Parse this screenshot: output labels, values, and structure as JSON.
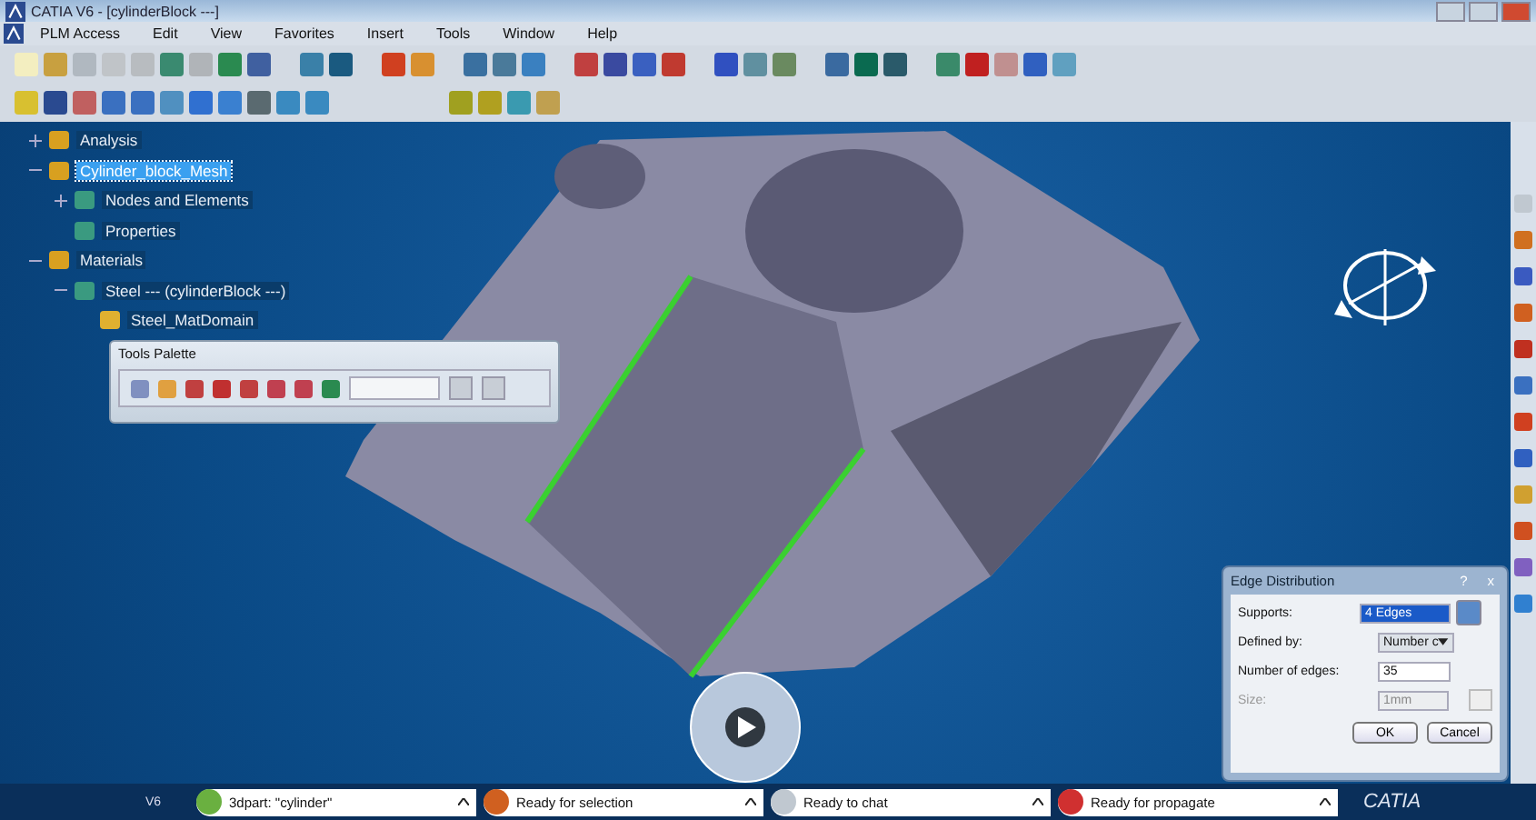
{
  "window": {
    "title": "CATIA V6 - [cylinderBlock ---]"
  },
  "menu": [
    "PLM Access",
    "Edit",
    "View",
    "Favorites",
    "Insert",
    "Tools",
    "Window",
    "Help"
  ],
  "tree": [
    {
      "label": "Analysis",
      "selected": false,
      "expanded": false
    },
    {
      "label": "Cylinder_block_Mesh",
      "selected": true,
      "expanded": true,
      "children": [
        {
          "label": "Nodes and Elements",
          "selected": false,
          "expanded": false
        },
        {
          "label": "Properties",
          "selected": false
        }
      ]
    },
    {
      "label": "Materials",
      "selected": false,
      "expanded": true,
      "children": [
        {
          "label": "Steel --- (cylinderBlock ---)",
          "selected": false,
          "expanded": true,
          "children": [
            {
              "label": "Steel_MatDomain",
              "selected": false
            }
          ]
        }
      ]
    }
  ],
  "tools_palette": {
    "title": "Tools Palette"
  },
  "dialog": {
    "title": "Edge Distribution",
    "help": "?",
    "close": "x",
    "fields": [
      {
        "kind": "select-field",
        "label": "Supports:",
        "value": "4 Edges",
        "disabled": false
      },
      {
        "kind": "dropdown",
        "label": "Defined by:",
        "value": "Number c",
        "disabled": false
      },
      {
        "kind": "text",
        "label": "Number of edges:",
        "value": "35",
        "disabled": false
      },
      {
        "kind": "text",
        "label": "Size:",
        "value": "1mm",
        "disabled": true
      }
    ],
    "buttons": [
      "OK",
      "Cancel"
    ]
  },
  "status_bar": {
    "version": "V6",
    "segments": [
      "3dpart: \"cylinder\"",
      "Ready for selection",
      "Ready to chat",
      "Ready for propagate"
    ],
    "brand": "CATIA"
  }
}
